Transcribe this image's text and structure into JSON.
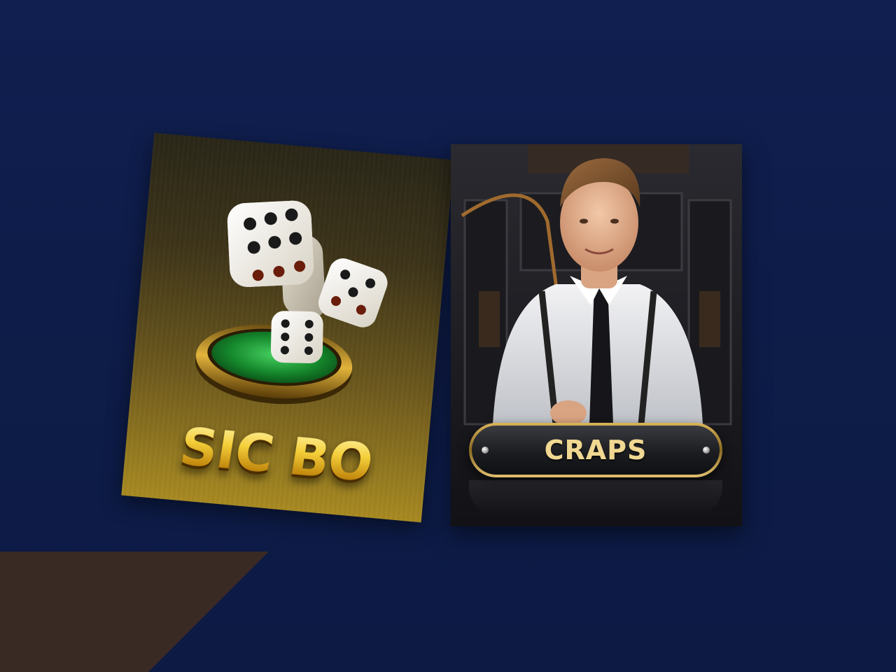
{
  "cards": {
    "sicbo": {
      "title": "SIC BO"
    },
    "craps": {
      "title": "CRAPS"
    }
  },
  "colors": {
    "background": "#0f1d4a",
    "corner_accent": "#3a2a24",
    "gold": "#f4cf3a",
    "craps_label": "#f1d892",
    "felt_green": "#1f9a3a"
  },
  "icons": [
    "dice-icon",
    "dealer-portrait"
  ]
}
